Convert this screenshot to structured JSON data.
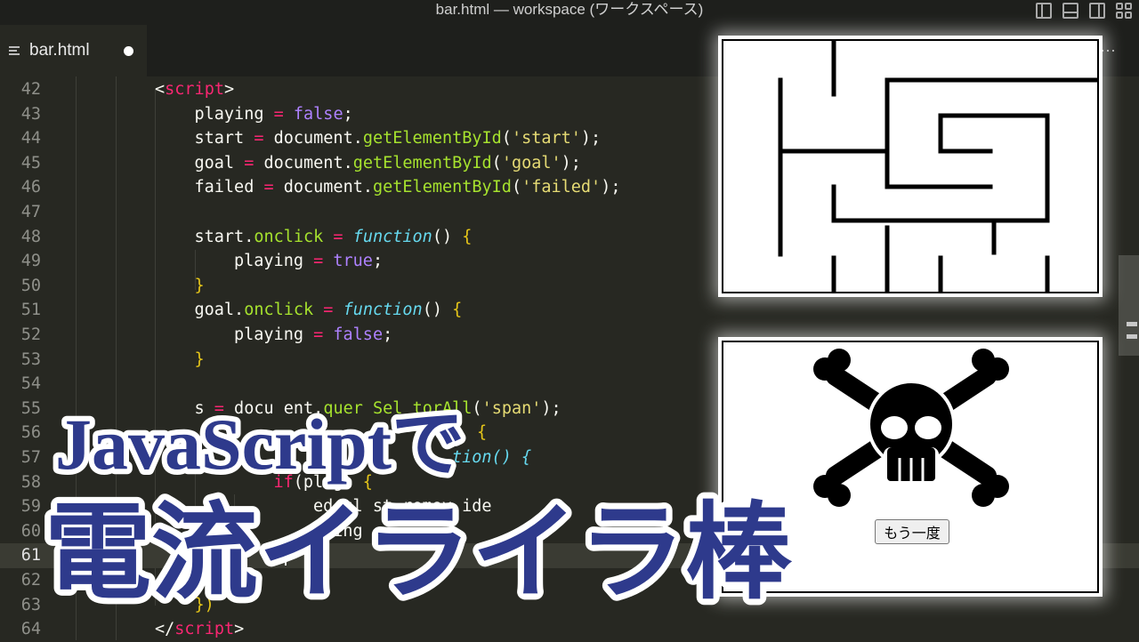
{
  "window": {
    "title": "bar.html — workspace (ワークスペース)"
  },
  "tab": {
    "label": "bar.html",
    "dirty": true
  },
  "tab_bar": {
    "more_label": "···"
  },
  "editor": {
    "lines": [
      {
        "number": "42",
        "indent": 2,
        "tokens": [
          [
            "t-punc",
            "<"
          ],
          [
            "t-tag",
            "script"
          ],
          [
            "t-punc",
            ">"
          ]
        ]
      },
      {
        "number": "43",
        "indent": 3,
        "tokens": [
          [
            "",
            "playing "
          ],
          [
            "t-op",
            "="
          ],
          [
            "t-kw",
            " false"
          ],
          [
            "",
            ";"
          ]
        ]
      },
      {
        "number": "44",
        "indent": 3,
        "tokens": [
          [
            "",
            "start "
          ],
          [
            "t-op",
            "="
          ],
          [
            "",
            " document."
          ],
          [
            "t-fn",
            "getElementById"
          ],
          [
            "",
            "("
          ],
          [
            "t-str",
            "'start'"
          ],
          [
            "",
            ");"
          ]
        ]
      },
      {
        "number": "45",
        "indent": 3,
        "tokens": [
          [
            "",
            "goal "
          ],
          [
            "t-op",
            "="
          ],
          [
            "",
            " document."
          ],
          [
            "t-fn",
            "getElementById"
          ],
          [
            "",
            "("
          ],
          [
            "t-str",
            "'goal'"
          ],
          [
            "",
            ");"
          ]
        ]
      },
      {
        "number": "46",
        "indent": 3,
        "tokens": [
          [
            "",
            "failed "
          ],
          [
            "t-op",
            "="
          ],
          [
            "",
            " document."
          ],
          [
            "t-fn",
            "getElementById"
          ],
          [
            "",
            "("
          ],
          [
            "t-str",
            "'failed'"
          ],
          [
            "",
            ");"
          ]
        ]
      },
      {
        "number": "47",
        "indent": 0,
        "tokens": []
      },
      {
        "number": "48",
        "indent": 3,
        "tokens": [
          [
            "",
            "start."
          ],
          [
            "t-fn",
            "onclick"
          ],
          [
            "t-op",
            " ="
          ],
          [
            "t-func",
            " function"
          ],
          [
            "",
            "() "
          ],
          [
            "t-brace",
            "{"
          ]
        ]
      },
      {
        "number": "49",
        "indent": 4,
        "tokens": [
          [
            "",
            "playing "
          ],
          [
            "t-op",
            "="
          ],
          [
            "t-kw",
            " true"
          ],
          [
            "",
            ";"
          ]
        ]
      },
      {
        "number": "50",
        "indent": 3,
        "tokens": [
          [
            "t-brace",
            "}"
          ]
        ]
      },
      {
        "number": "51",
        "indent": 3,
        "tokens": [
          [
            "",
            "goal."
          ],
          [
            "t-fn",
            "onclick"
          ],
          [
            "t-op",
            " ="
          ],
          [
            "t-func",
            " function"
          ],
          [
            "",
            "() "
          ],
          [
            "t-brace",
            "{"
          ]
        ]
      },
      {
        "number": "52",
        "indent": 4,
        "tokens": [
          [
            "",
            "playing "
          ],
          [
            "t-op",
            "="
          ],
          [
            "t-kw",
            " false"
          ],
          [
            "",
            ";"
          ]
        ]
      },
      {
        "number": "53",
        "indent": 3,
        "tokens": [
          [
            "t-brace",
            "}"
          ]
        ]
      },
      {
        "number": "54",
        "indent": 0,
        "tokens": []
      },
      {
        "number": "55",
        "indent": 3,
        "tokens": [
          [
            "",
            "s"
          ],
          [
            "",
            " "
          ],
          [
            "t-op",
            "="
          ],
          [
            "",
            " docu"
          ],
          [
            "",
            " "
          ],
          [
            "",
            "ent."
          ],
          [
            "t-fn",
            "quer"
          ],
          [
            "",
            " "
          ],
          [
            "t-fn",
            "Sel"
          ],
          [
            "",
            " "
          ],
          [
            "t-fn",
            "torAll"
          ],
          [
            "",
            "("
          ],
          [
            "t-str",
            "'span'"
          ],
          [
            "",
            ");"
          ]
        ]
      },
      {
        "number": "56",
        "indent": 3,
        "tokens": []
      },
      {
        "number": "57",
        "indent": 3,
        "tokens": []
      },
      {
        "number": "58",
        "indent": 5,
        "tokens": [
          [
            "t-if",
            "if"
          ],
          [
            "",
            "(pl"
          ],
          [
            "",
            " "
          ],
          [
            "",
            "g) "
          ],
          [
            "t-brace",
            "{"
          ]
        ]
      },
      {
        "number": "59",
        "indent": 6,
        "tokens": [
          [
            "",
            "ed.cl"
          ],
          [
            "",
            " "
          ],
          [
            "",
            "st.remov"
          ],
          [
            "",
            " "
          ],
          [
            "",
            "ide"
          ]
        ]
      },
      {
        "number": "60",
        "indent": 6,
        "tokens": [
          [
            "",
            "aying"
          ]
        ]
      },
      {
        "number": "61",
        "indent": 5,
        "tokens": [],
        "current": true
      },
      {
        "number": "62",
        "indent": 4,
        "tokens": []
      },
      {
        "number": "63",
        "indent": 3,
        "tokens": [
          [
            "t-brace",
            "})"
          ]
        ]
      },
      {
        "number": "64",
        "indent": 2,
        "tokens": [
          [
            "t-punc",
            "</"
          ],
          [
            "t-tag",
            "script"
          ],
          [
            "t-punc",
            ">"
          ]
        ]
      }
    ],
    "fragments": {
      "line56_tail": "{",
      "line57_tail": "tion() {"
    }
  },
  "preview": {
    "maze_label": "maze",
    "retry_button": "もう一度"
  },
  "headline": {
    "line1": "JavaScriptで",
    "line2": "電流イライラ棒"
  },
  "colors": {
    "editor_bg": "#272822",
    "headline_fill": "#2e3a8c",
    "headline_stroke": "#ffffff"
  }
}
